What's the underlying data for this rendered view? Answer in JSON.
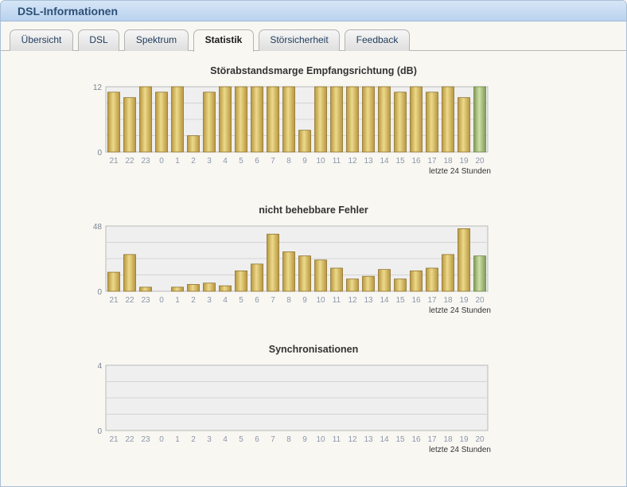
{
  "window": {
    "title": "DSL-Informationen"
  },
  "tabs": [
    {
      "id": "uebersicht",
      "label": "Übersicht",
      "active": false
    },
    {
      "id": "dsl",
      "label": "DSL",
      "active": false
    },
    {
      "id": "spektrum",
      "label": "Spektrum",
      "active": false
    },
    {
      "id": "statistik",
      "label": "Statistik",
      "active": true
    },
    {
      "id": "stoersicherheit",
      "label": "Störsicherheit",
      "active": false
    },
    {
      "id": "feedback",
      "label": "Feedback",
      "active": false
    }
  ],
  "colors": {
    "bar_gold_light": "#ecd98a",
    "bar_gold_dark": "#b8963f",
    "bar_green_light": "#cfe0a6",
    "bar_green_dark": "#7f9a55",
    "plot_bg": "#efefef",
    "gridline": "#d4d4d4"
  },
  "chart_data": [
    {
      "type": "bar",
      "title": "Störabstandsmarge Empfangsrichtung (dB)",
      "categories": [
        "21",
        "22",
        "23",
        "0",
        "1",
        "2",
        "3",
        "4",
        "5",
        "6",
        "7",
        "8",
        "9",
        "10",
        "11",
        "12",
        "13",
        "14",
        "15",
        "16",
        "17",
        "18",
        "19",
        "20"
      ],
      "values": [
        11,
        10,
        12,
        11,
        12,
        3,
        11,
        12,
        12,
        12,
        12,
        12,
        4,
        12,
        12,
        12,
        12,
        12,
        11,
        12,
        11,
        12,
        10,
        12
      ],
      "highlight_last": true,
      "ylim": [
        0,
        12
      ],
      "yticks": [
        "0",
        "12"
      ],
      "caption": "letzte 24 Stunden",
      "grid": true
    },
    {
      "type": "bar",
      "title": "nicht behebbare Fehler",
      "categories": [
        "21",
        "22",
        "23",
        "0",
        "1",
        "2",
        "3",
        "4",
        "5",
        "6",
        "7",
        "8",
        "9",
        "10",
        "11",
        "12",
        "13",
        "14",
        "15",
        "16",
        "17",
        "18",
        "19",
        "20"
      ],
      "values": [
        14,
        27,
        3,
        0,
        3,
        5,
        6,
        4,
        15,
        20,
        42,
        29,
        26,
        23,
        17,
        9,
        11,
        16,
        9,
        15,
        17,
        27,
        46,
        26
      ],
      "highlight_last": true,
      "ylim": [
        0,
        48
      ],
      "yticks": [
        "0",
        "48"
      ],
      "caption": "letzte 24 Stunden",
      "grid": true
    },
    {
      "type": "bar",
      "title": "Synchronisationen",
      "categories": [
        "21",
        "22",
        "23",
        "0",
        "1",
        "2",
        "3",
        "4",
        "5",
        "6",
        "7",
        "8",
        "9",
        "10",
        "11",
        "12",
        "13",
        "14",
        "15",
        "16",
        "17",
        "18",
        "19",
        "20"
      ],
      "values": [
        0,
        0,
        0,
        0,
        0,
        0,
        0,
        0,
        0,
        0,
        0,
        0,
        0,
        0,
        0,
        0,
        0,
        0,
        0,
        0,
        0,
        0,
        0,
        0
      ],
      "highlight_last": false,
      "ylim": [
        0,
        4
      ],
      "yticks": [
        "0",
        "4"
      ],
      "caption": "letzte 24 Stunden",
      "grid": true
    }
  ]
}
